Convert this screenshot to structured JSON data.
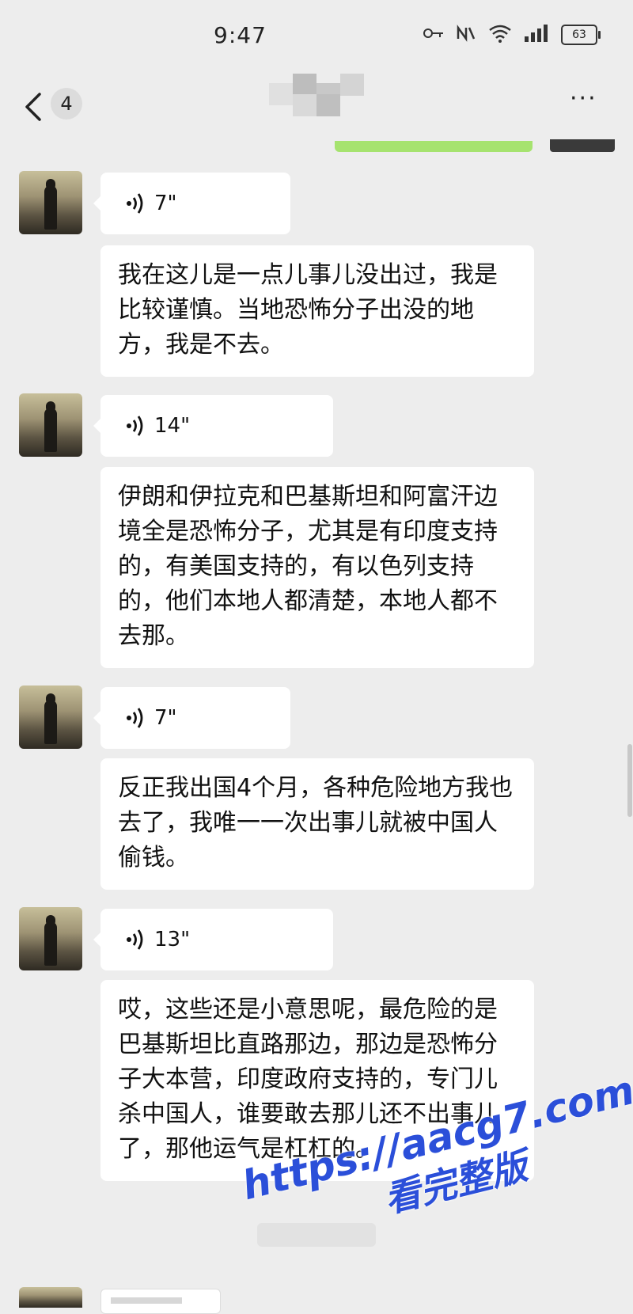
{
  "status_bar": {
    "time": "9:47",
    "battery": "63"
  },
  "header": {
    "unread_count": "4",
    "more_label": "···"
  },
  "messages": [
    {
      "voice_duration": "7\"",
      "text": "我在这儿是一点儿事儿没出过，我是比较谨慎。当地恐怖分子出没的地方，我是不去。"
    },
    {
      "voice_duration": "14\"",
      "text": "伊朗和伊拉克和巴基斯坦和阿富汗边境全是恐怖分子，尤其是有印度支持的，有美国支持的，有以色列支持的，他们本地人都清楚，本地人都不去那。"
    },
    {
      "voice_duration": "7\"",
      "text": "反正我出国4个月，各种危险地方我也去了，我唯一一次出事儿就被中国人偷钱。"
    },
    {
      "voice_duration": "13\"",
      "text": "哎，这些还是小意思呢，最危险的是巴基斯坦比直路那边，那边是恐怖分子大本营，印度政府支持的，专门儿杀中国人，谁要敢去那儿还不出事儿了，那他运气是杠杠的。"
    }
  ],
  "watermark": {
    "url": "https://aacg7.com",
    "subtitle": "看完整版"
  },
  "colors": {
    "background": "#ededed",
    "bubble": "#ffffff",
    "sent_bubble": "#a6e36f",
    "watermark": "#2b4fd9"
  }
}
